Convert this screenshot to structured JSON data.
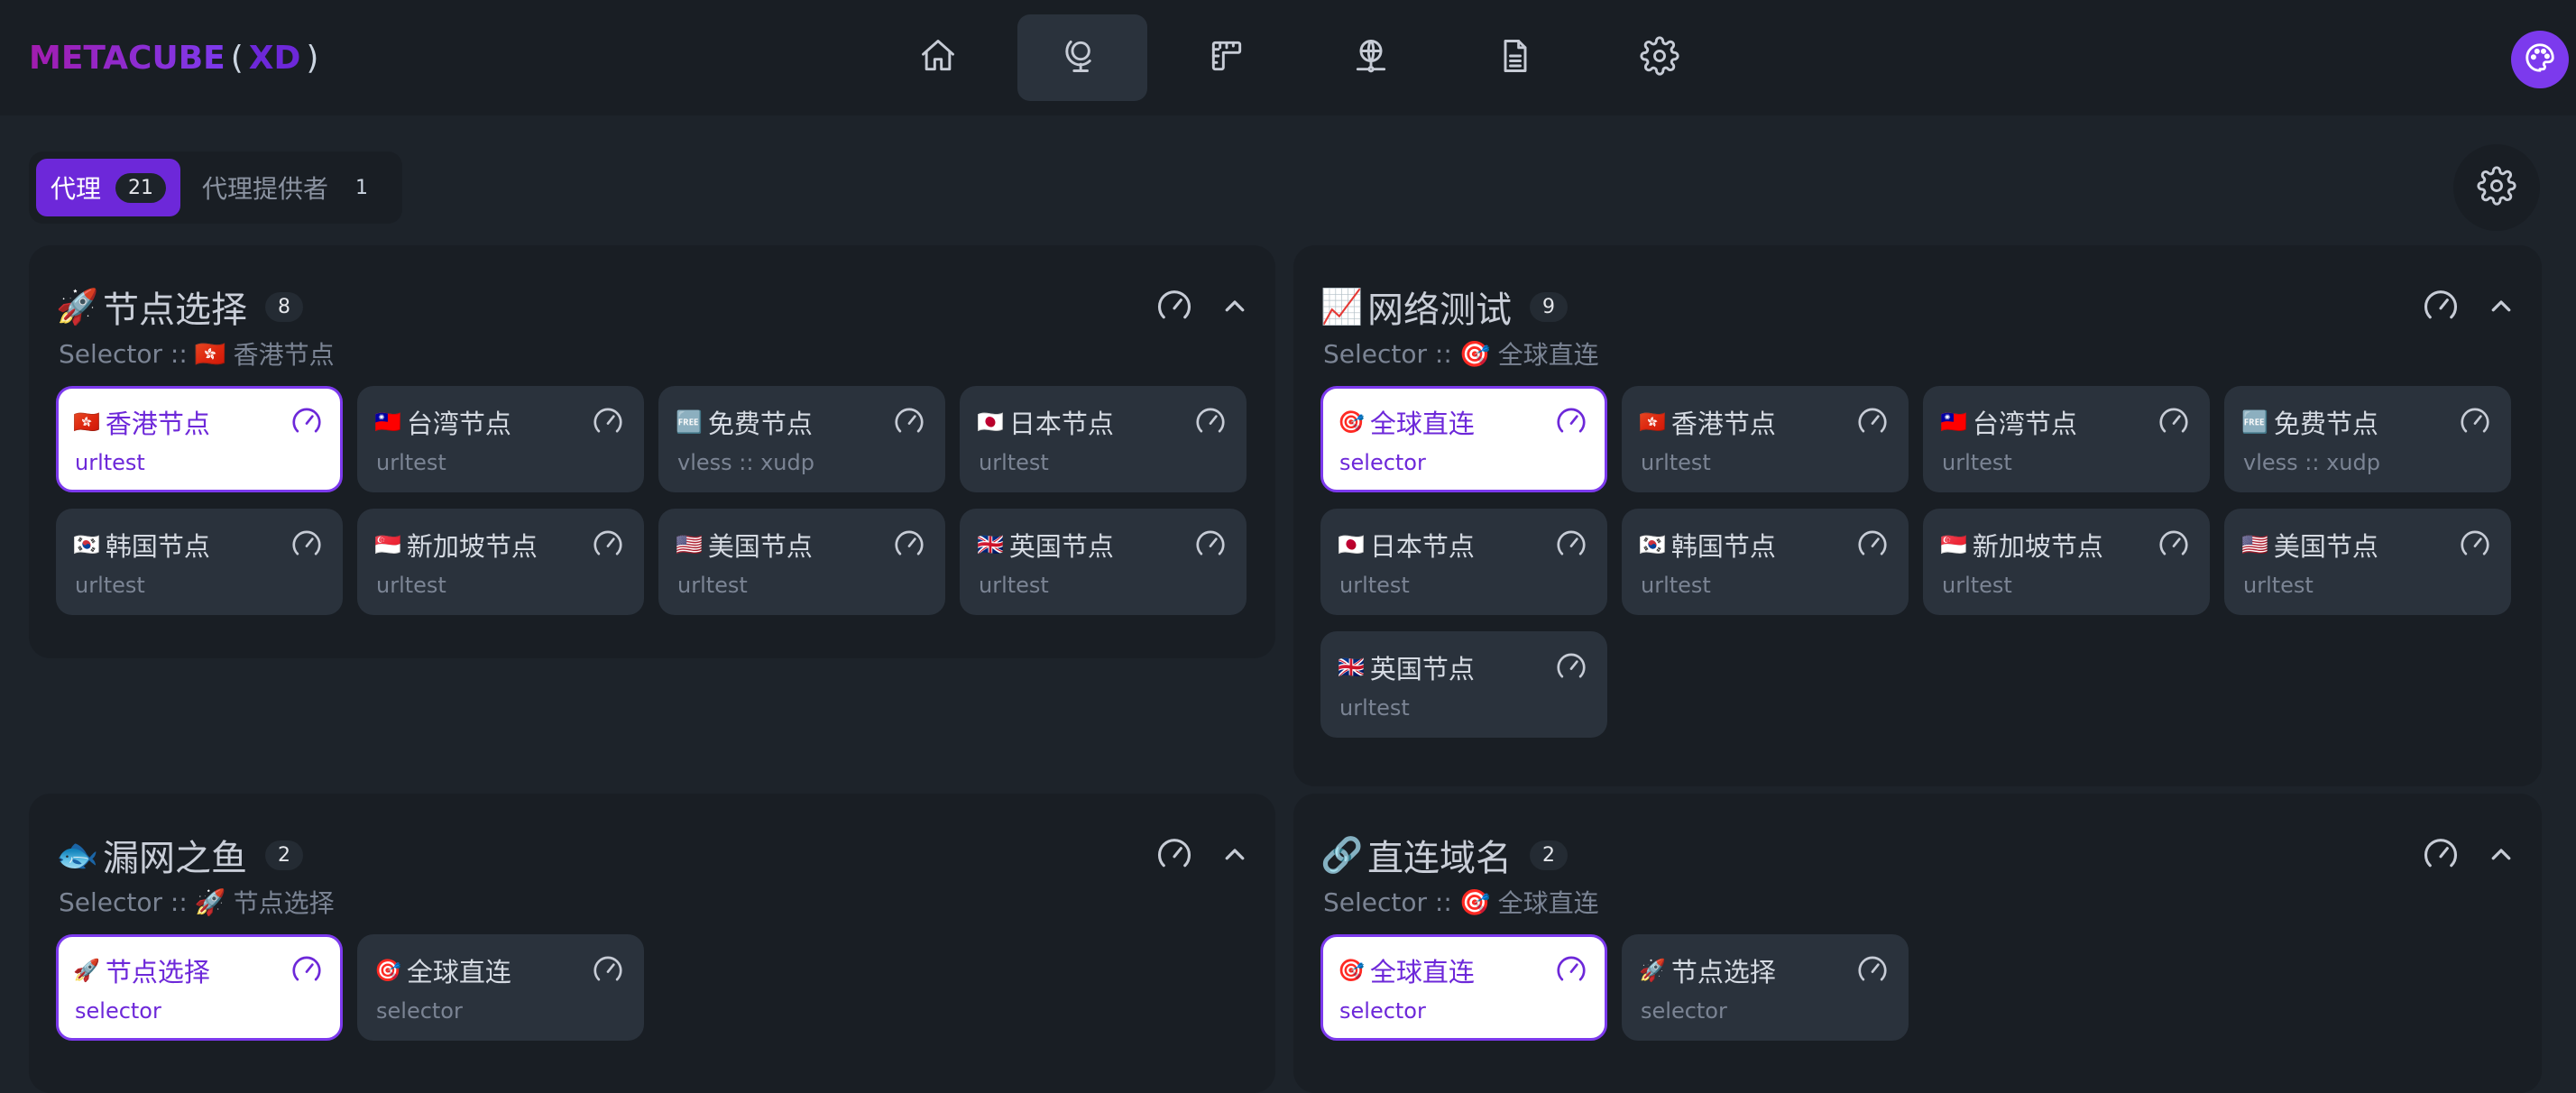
{
  "app": {
    "logo_brand": "METACUBE",
    "logo_open": "(",
    "logo_xd": "XD",
    "logo_close": ")"
  },
  "nav": [
    {
      "name": "home",
      "icon": "home-icon"
    },
    {
      "name": "proxies",
      "icon": "globe-stand-icon",
      "active": true
    },
    {
      "name": "rules",
      "icon": "ruler-icon"
    },
    {
      "name": "connections",
      "icon": "network-globe-icon"
    },
    {
      "name": "logs",
      "icon": "file-icon"
    },
    {
      "name": "config",
      "icon": "gear-icon"
    }
  ],
  "theme_button": {
    "icon": "palette-icon"
  },
  "tabs": [
    {
      "label": "代理",
      "count": "21",
      "active": true
    },
    {
      "label": "代理提供者",
      "count": "1",
      "active": false
    }
  ],
  "groups": [
    {
      "emoji": "🚀",
      "title": "节点选择",
      "count": "8",
      "sub_prefix": "Selector ::",
      "sub_emoji": "🇭🇰",
      "sub_value": "香港节点",
      "nodes": [
        {
          "flag": "🇭🇰",
          "name": "香港节点",
          "type": "urltest",
          "selected": true
        },
        {
          "flag": "🇹🇼",
          "name": "台湾节点",
          "type": "urltest"
        },
        {
          "flag": "🆓",
          "name": "免费节点",
          "type": "vless :: xudp"
        },
        {
          "flag": "🇯🇵",
          "name": "日本节点",
          "type": "urltest"
        },
        {
          "flag": "🇰🇷",
          "name": "韩国节点",
          "type": "urltest"
        },
        {
          "flag": "🇸🇬",
          "name": "新加坡节点",
          "type": "urltest"
        },
        {
          "flag": "🇺🇸",
          "name": "美国节点",
          "type": "urltest"
        },
        {
          "flag": "🇬🇧",
          "name": "英国节点",
          "type": "urltest"
        }
      ]
    },
    {
      "emoji": "📈",
      "title": "网络测试",
      "count": "9",
      "sub_prefix": "Selector ::",
      "sub_emoji": "🎯",
      "sub_value": "全球直连",
      "nodes": [
        {
          "flag": "🎯",
          "name": "全球直连",
          "type": "selector",
          "selected": true
        },
        {
          "flag": "🇭🇰",
          "name": "香港节点",
          "type": "urltest"
        },
        {
          "flag": "🇹🇼",
          "name": "台湾节点",
          "type": "urltest"
        },
        {
          "flag": "🆓",
          "name": "免费节点",
          "type": "vless :: xudp"
        },
        {
          "flag": "🇯🇵",
          "name": "日本节点",
          "type": "urltest"
        },
        {
          "flag": "🇰🇷",
          "name": "韩国节点",
          "type": "urltest"
        },
        {
          "flag": "🇸🇬",
          "name": "新加坡节点",
          "type": "urltest"
        },
        {
          "flag": "🇺🇸",
          "name": "美国节点",
          "type": "urltest"
        },
        {
          "flag": "🇬🇧",
          "name": "英国节点",
          "type": "urltest"
        }
      ]
    },
    {
      "emoji": "🐟",
      "title": "漏网之鱼",
      "count": "2",
      "sub_prefix": "Selector ::",
      "sub_emoji": "🚀",
      "sub_value": "节点选择",
      "nodes": [
        {
          "flag": "🚀",
          "name": "节点选择",
          "type": "selector",
          "selected": true
        },
        {
          "flag": "🎯",
          "name": "全球直连",
          "type": "selector"
        }
      ]
    },
    {
      "emoji": "🔗",
      "title": "直连域名",
      "count": "2",
      "sub_prefix": "Selector ::",
      "sub_emoji": "🎯",
      "sub_value": "全球直连",
      "nodes": [
        {
          "flag": "🎯",
          "name": "全球直连",
          "type": "selector",
          "selected": true
        },
        {
          "flag": "🚀",
          "name": "节点选择",
          "type": "selector"
        }
      ]
    }
  ],
  "colors": {
    "accent": "#7c3aed",
    "background": "#1d232a",
    "panel": "#191e24",
    "card": "#2a323c",
    "selected_card": "#ffffff"
  }
}
